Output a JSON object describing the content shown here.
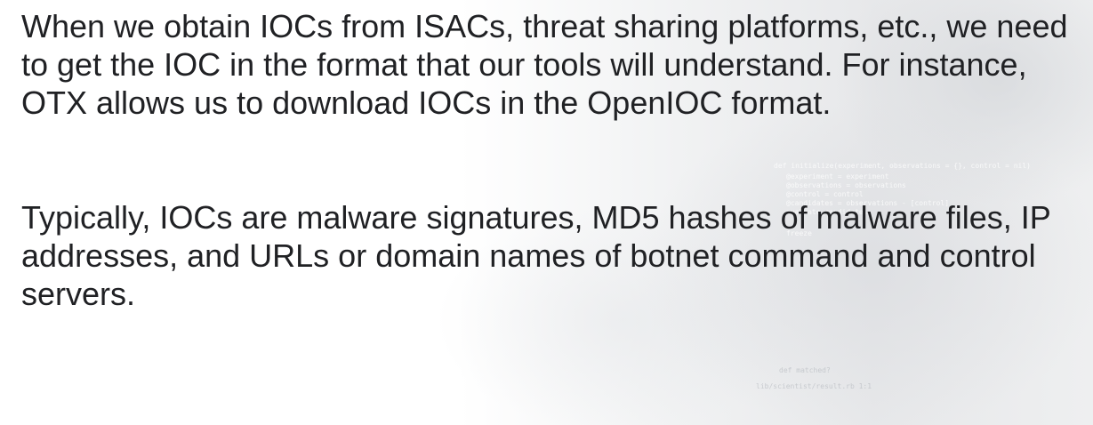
{
  "paragraphs": [
    "When we obtain IOCs from ISACs, threat sharing platforms, etc., we need to get the IOC in the format that our tools will understand. For instance, OTX allows us to download IOCs in the OpenIOC format.",
    "Typically, IOCs are malware signatures, MD5 hashes of malware files, IP addresses, and URLs or domain names of botnet command and control servers."
  ],
  "background": {
    "image": "code-on-monitor-photo",
    "code_lines": [
      "def initialize(experiment, observations = {}, control = nil)",
      "@experiment   = experiment",
      "@observations = observations",
      "@control      = control",
      "@candidates   = observations - [control]",
      "evaluate_candidates",
      "freeze",
      "def matched?",
      "lib/scientist/result.rb 1:1"
    ]
  }
}
